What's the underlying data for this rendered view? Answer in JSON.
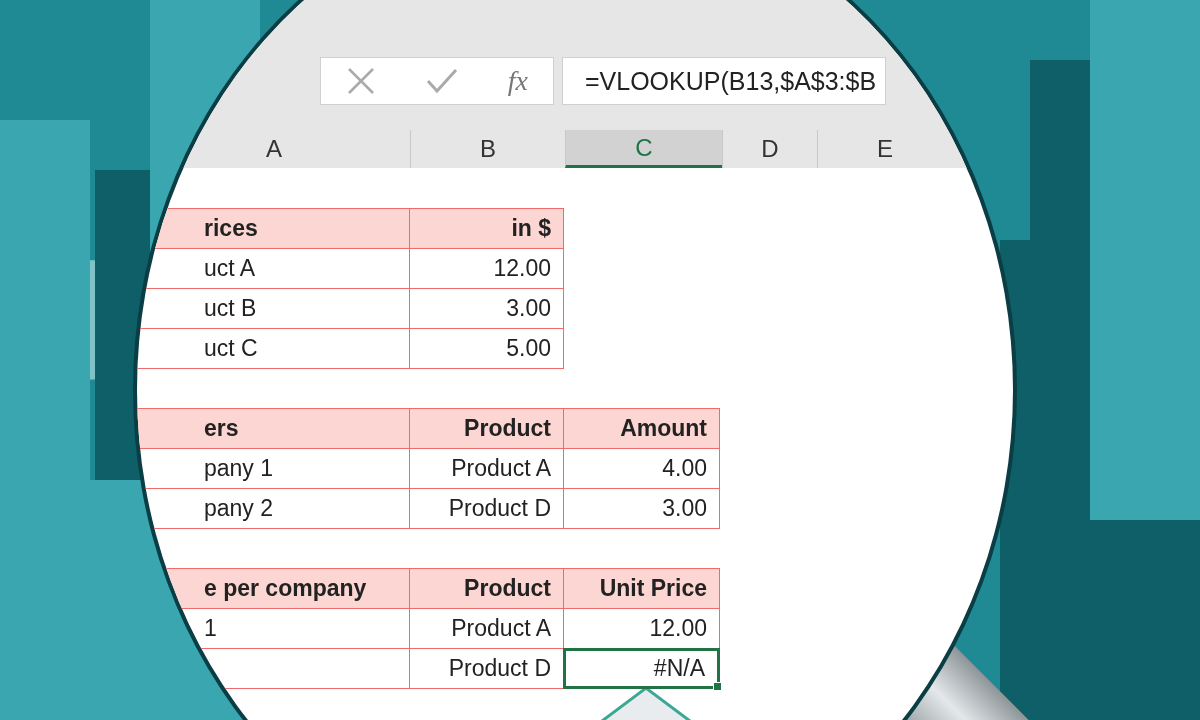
{
  "formula_bar": {
    "function_label": "fx",
    "formula": "=VLOOKUP(B13,$A$3:$B"
  },
  "columns": [
    {
      "label": "A",
      "selected": false
    },
    {
      "label": "B",
      "selected": false
    },
    {
      "label": "C",
      "selected": true
    },
    {
      "label": "D",
      "selected": false
    },
    {
      "label": "E",
      "selected": false
    }
  ],
  "tables": [
    {
      "header": [
        "rices",
        "in $"
      ],
      "rows": [
        [
          {
            "text": "uct A",
            "selected": false
          },
          {
            "text": "12.00",
            "selected": false
          }
        ],
        [
          {
            "text": "uct B",
            "selected": false
          },
          {
            "text": "3.00",
            "selected": false
          }
        ],
        [
          {
            "text": "uct C",
            "selected": false
          },
          {
            "text": "5.00",
            "selected": false
          }
        ]
      ]
    },
    {
      "header": [
        "ers",
        "Product",
        "Amount"
      ],
      "rows": [
        [
          {
            "text": "pany 1",
            "selected": false
          },
          {
            "text": "Product A",
            "selected": false
          },
          {
            "text": "4.00",
            "selected": false
          }
        ],
        [
          {
            "text": "pany 2",
            "selected": false
          },
          {
            "text": "Product D",
            "selected": false
          },
          {
            "text": "3.00",
            "selected": false
          }
        ]
      ]
    },
    {
      "header": [
        "e per company",
        "Product",
        "Unit Price"
      ],
      "rows": [
        [
          {
            "text": "1",
            "selected": false
          },
          {
            "text": "Product A",
            "selected": false
          },
          {
            "text": "12.00",
            "selected": false
          }
        ],
        [
          {
            "text": null,
            "selected": false
          },
          {
            "text": "Product D",
            "selected": false
          },
          {
            "text": "#N/A",
            "selected": true
          }
        ]
      ]
    }
  ]
}
